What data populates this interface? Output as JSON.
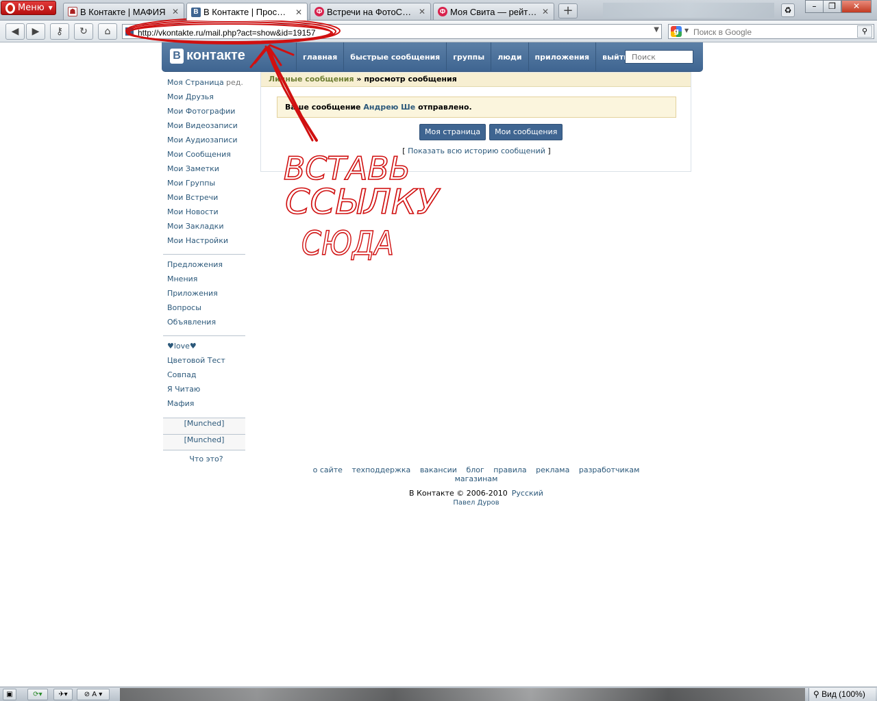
{
  "browser": {
    "menu_label": "Меню",
    "tabs": [
      {
        "label": "В Контакте | МАФИЯ"
      },
      {
        "label": "В Контакте | Просмот..."
      },
      {
        "label": "Встречи на ФотоСтране"
      },
      {
        "label": "Моя Свита — рейтинги"
      }
    ],
    "address": "http://vkontakte.ru/mail.php?act=show&id=19157",
    "search_placeholder": "Поиск в Google",
    "zoom_label": "Вид (100%)"
  },
  "vk": {
    "logo_text": "контакте",
    "logo_letter": "В",
    "nav": [
      "главная",
      "быстрые сообщения",
      "группы",
      "люди",
      "приложения",
      "выйти"
    ],
    "search_placeholder": "Поиск",
    "sidebar": {
      "main": [
        "Моя Страница",
        "Мои Друзья",
        "Мои Фотографии",
        "Мои Видеозаписи",
        "Мои Аудиозаписи",
        "Мои Сообщения",
        "Мои Заметки",
        "Мои Группы",
        "Мои Встречи",
        "Мои Новости",
        "Мои Закладки",
        "Мои Настройки"
      ],
      "edit_label": "ред.",
      "extra": [
        "Предложения",
        "Мнения",
        "Приложения",
        "Вопросы",
        "Объявления"
      ],
      "apps": [
        "♥love♥",
        "Цветовой Тест",
        "Совпад",
        "Я Читаю",
        "Мафия"
      ],
      "munched": [
        "[Munched]",
        "[Munched]"
      ],
      "what_is_it": "Что это?"
    },
    "breadcrumb": {
      "link": "Личные сообщения",
      "separator": " » ",
      "current": "просмотр сообщения"
    },
    "notice": {
      "prefix": "Ваше сообщение ",
      "recipient": "Андрею Ше",
      "suffix": " отправлено."
    },
    "buttons": {
      "my_page": "Моя страница",
      "my_messages": "Мои сообщения"
    },
    "history": {
      "open": "[ ",
      "link": "Показать всю историю сообщений",
      "close": " ]"
    },
    "footer": {
      "links": [
        "о сайте",
        "техподдержка",
        "вакансии",
        "блог",
        "правила",
        "реклама",
        "разработчикам",
        "магазинам"
      ],
      "copyright": "В Контакте © 2006-2010",
      "language": "Русский",
      "author": "Павел Дуров"
    }
  },
  "annotation": {
    "line1": "ВСТАВЬ",
    "line2": "ССЫЛКУ",
    "line3": "СЮДА",
    "color": "#d01010"
  }
}
